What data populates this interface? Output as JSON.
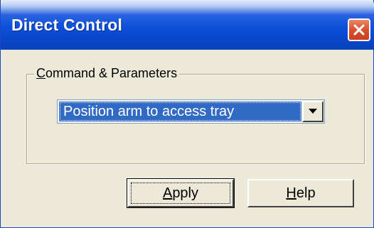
{
  "window": {
    "title": "Direct Control"
  },
  "group": {
    "legend_accel": "C",
    "legend_rest": "ommand & Parameters"
  },
  "command_select": {
    "selected": "Position arm to access tray"
  },
  "buttons": {
    "apply_accel": "A",
    "apply_rest": "pply",
    "help_accel": "H",
    "help_rest": "elp"
  },
  "icons": {
    "close": "close-x",
    "dropdown": "chevron-down"
  },
  "colors": {
    "titlebar": "#0a46c8",
    "close": "#d9502f",
    "selection": "#316ac5",
    "dialog_bg": "#ece9d8"
  }
}
